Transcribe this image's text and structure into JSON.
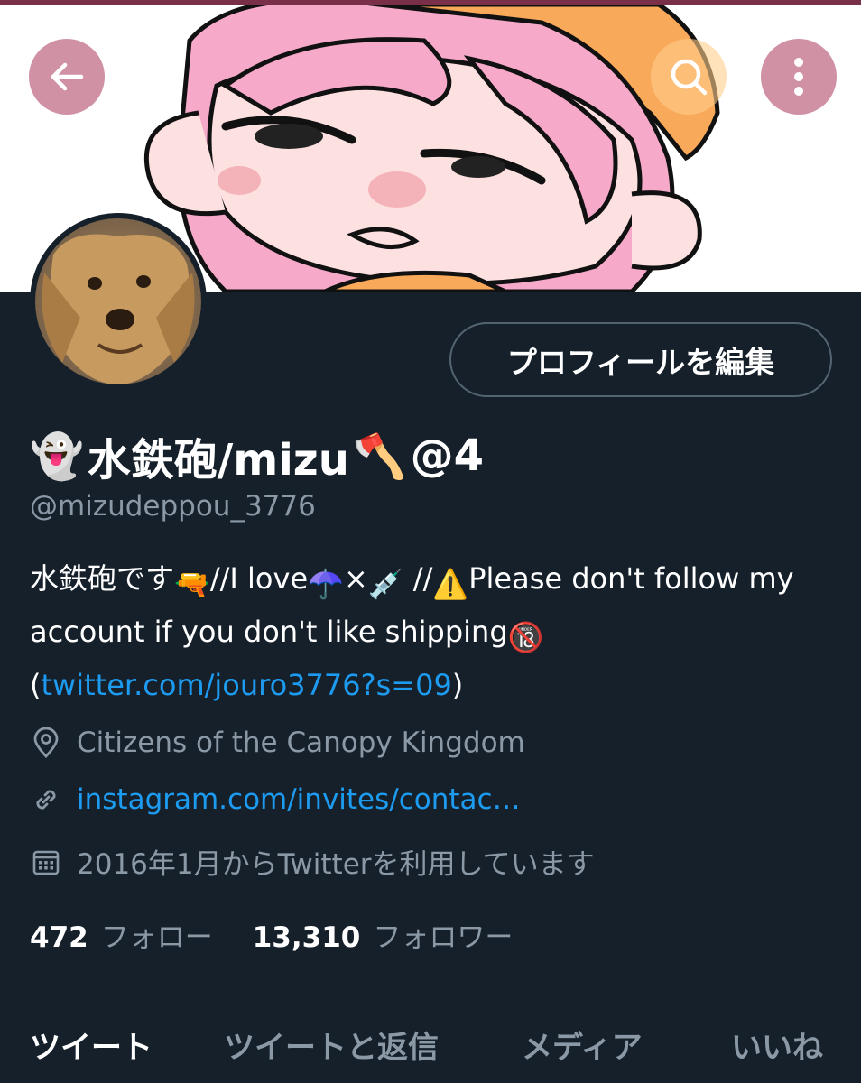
{
  "header": {
    "back_icon": "arrow-left-icon",
    "search_icon": "search-icon",
    "more_icon": "more-vertical-icon"
  },
  "profile": {
    "edit_button_label": "プロフィールを編集",
    "display_name": {
      "lead_emoji": "👻",
      "text": "水鉄砲/mizu",
      "trail_emoji": "🪓",
      "suffix": "@4"
    },
    "handle": "@mizudeppou_3776",
    "bio": {
      "part1": "水鉄砲です",
      "emoji_gun": "🔫",
      "part2": "//I love",
      "emoji_umbrella": "☂️",
      "part3": "×",
      "emoji_syringe": "💉",
      "part4": " //",
      "emoji_warning": "⚠️",
      "part5": "Please don't follow my account if you don't like shipping",
      "emoji_18": "🔞",
      "part6": "(",
      "link": "twitter.com/jouro3776?s=09",
      "part7": ")"
    },
    "location": "Citizens of the Canopy Kingdom",
    "website": "instagram.com/invites/contac…",
    "joined": "2016年1月からTwitterを利用しています",
    "following_count": "472",
    "following_label": "フォロー",
    "followers_count": "13,310",
    "followers_label": "フォロワー"
  },
  "tabs": [
    {
      "label": "ツイート",
      "active": true
    },
    {
      "label": "ツイートと返信",
      "active": false
    },
    {
      "label": "メディア",
      "active": false
    },
    {
      "label": "いいね",
      "active": false
    }
  ],
  "colors": {
    "background": "#15202b",
    "text_secondary": "#8b98a5",
    "link": "#1d9bf0",
    "border": "#536471"
  }
}
